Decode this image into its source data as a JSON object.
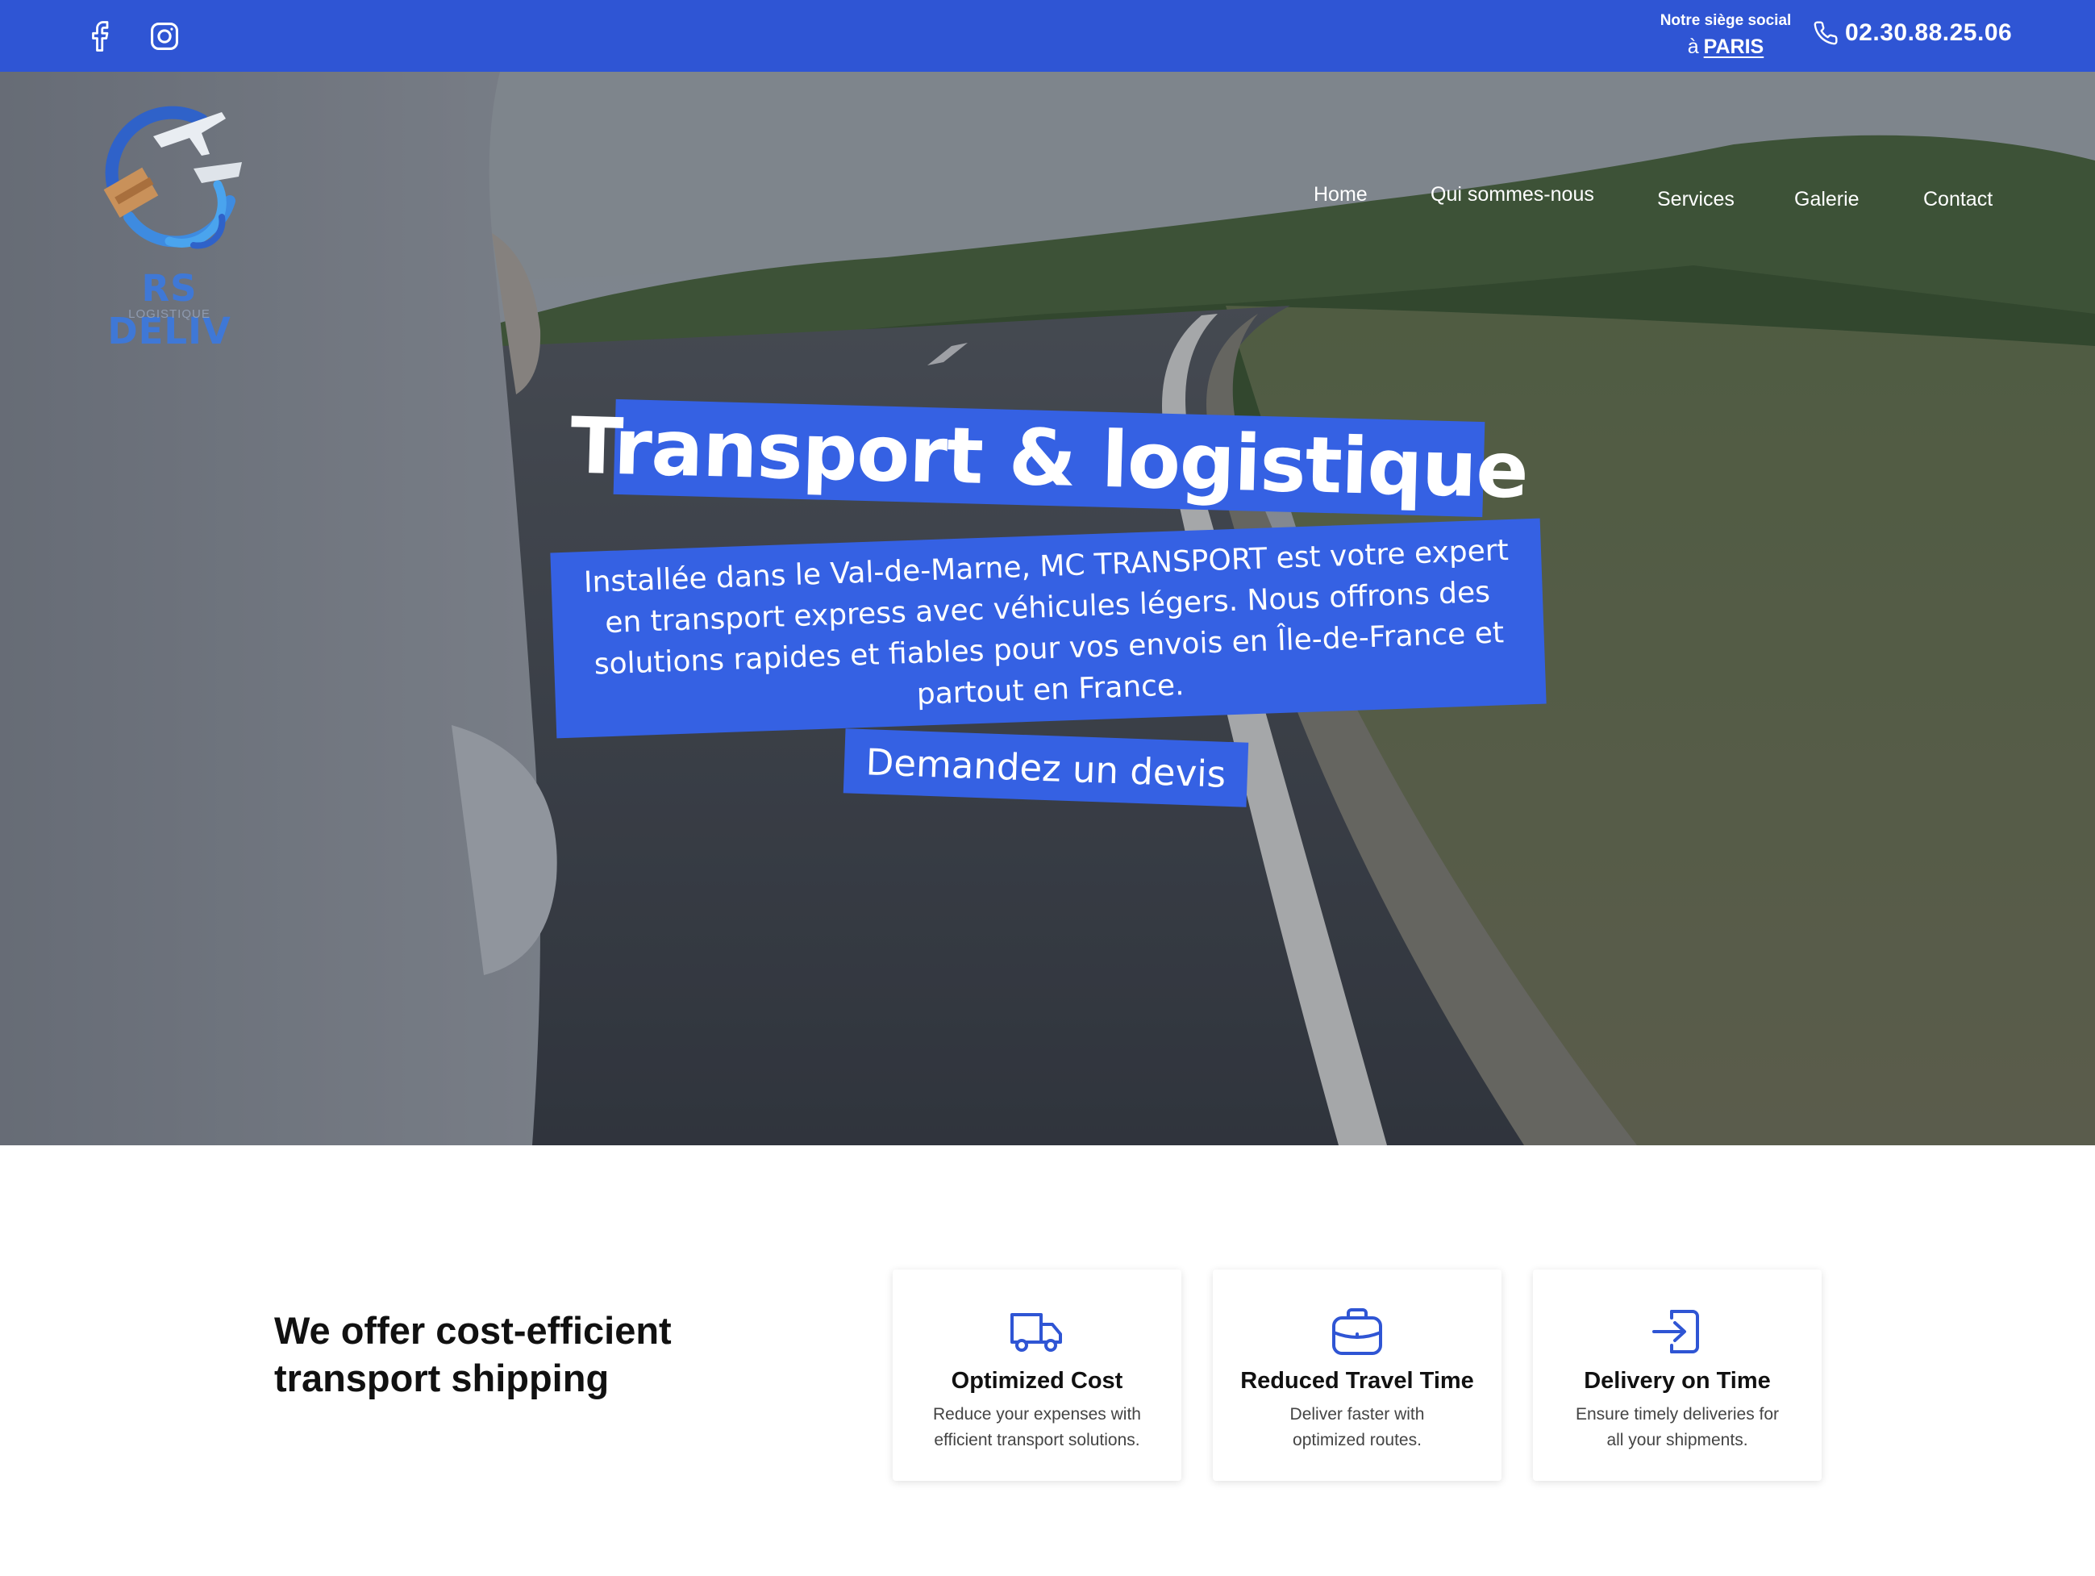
{
  "topbar": {
    "hq_line1": "Notre siège social",
    "hq_prefix": "à",
    "hq_city": "PARIS",
    "phone": "02.30.88.25.06"
  },
  "logo": {
    "brand": "RS DELIV",
    "tagline": "LOGISTIQUE"
  },
  "nav": [
    "Home",
    "Qui sommes-nous",
    "Services",
    "Galerie",
    "Contact"
  ],
  "hero": {
    "title": "Transport & logistique",
    "description": "Installée dans le Val-de-Marne, MC TRANSPORT est votre expert en transport express avec véhicules légers. Nous offrons des solutions rapides et fiables pour vos envois en Île-de-France et partout en France.",
    "cta": "Demandez un devis"
  },
  "features": {
    "title_line1": "We offer cost-efficient",
    "title_line2": "transport shipping",
    "cards": [
      {
        "icon": "truck-icon",
        "title": "Optimized Cost",
        "line1": "Reduce your expenses with",
        "line2": "efficient transport solutions."
      },
      {
        "icon": "briefcase-icon",
        "title": "Reduced Travel Time",
        "line1": "Deliver faster with",
        "line2": "optimized routes."
      },
      {
        "icon": "login-arrow-icon",
        "title": "Delivery on Time",
        "line1": "Ensure timely deliveries for",
        "line2": "all your shipments."
      }
    ]
  },
  "colors": {
    "brand_blue": "#2f55d4",
    "banner_blue": "#3561e3",
    "logo_blue": "#3f78d6"
  }
}
